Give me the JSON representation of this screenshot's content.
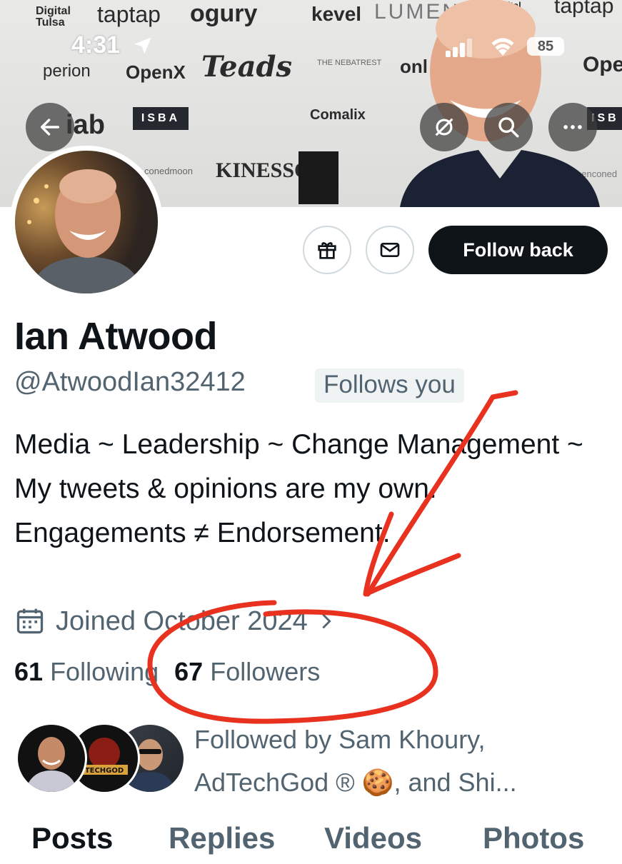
{
  "status_bar": {
    "time": "4:31",
    "battery": "85"
  },
  "banner": {
    "logos": [
      "Digital Tulsa",
      "taptap",
      "ogury",
      "kevel",
      "LUMEN",
      "Digital Age",
      "taptap",
      "perion",
      "OpenX",
      "Teads",
      "THE NEBATREST",
      "onl",
      "Open",
      "iab",
      "ISBA",
      "Comalix",
      "ISB",
      "KINESSO",
      "conedmoon",
      "casenconed"
    ]
  },
  "profile": {
    "name": "Ian Atwood",
    "handle": "@AtwoodIan32412",
    "follows_you": "Follows you",
    "bio": "Media ~ Leadership ~ Change Management ~ My tweets & opinions are my own. Engagements ≠ Endorsement.",
    "joined": "Joined October 2024",
    "following_count": "61",
    "following_label": "Following",
    "followers_count": "67",
    "followers_label": "Followers",
    "followed_by": "Followed by Sam Khoury, AdTechGod ® 🍪, and Shi..."
  },
  "actions": {
    "follow_back": "Follow back"
  },
  "tabs": [
    {
      "label": "Posts",
      "active": true
    },
    {
      "label": "Replies",
      "active": false
    },
    {
      "label": "Videos",
      "active": false
    },
    {
      "label": "Photos",
      "active": false
    }
  ],
  "colors": {
    "primary_text": "#0f1419",
    "secondary_text": "#536471",
    "annotation": "#e8311f"
  }
}
